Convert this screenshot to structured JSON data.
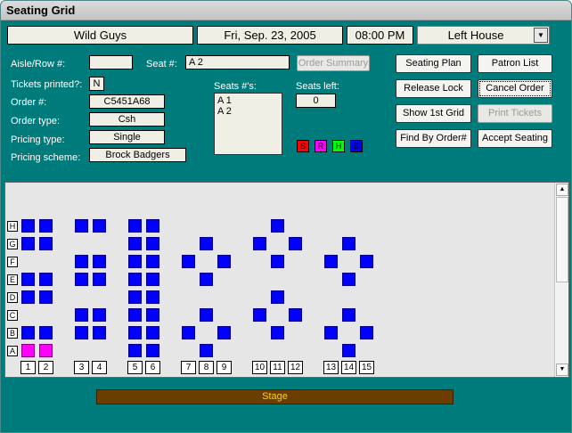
{
  "window": {
    "title": "Seating Grid"
  },
  "header": {
    "event": "Wild Guys",
    "date": "Fri, Sep. 23, 2005",
    "time": "08:00 PM",
    "section": "Left House"
  },
  "form": {
    "aisle_row_label": "Aisle/Row #:",
    "aisle_row_value": "",
    "seat_label": "Seat #:",
    "seat_value": "A 2",
    "tickets_printed_label": "Tickets printed?:",
    "tickets_printed_value": "N",
    "order_label": "Order #:",
    "order_value": "C5451A68",
    "order_type_label": "Order type:",
    "order_type_value": "Csh",
    "pricing_type_label": "Pricing type:",
    "pricing_type_value": "Single",
    "pricing_scheme_label": "Pricing scheme:",
    "pricing_scheme_value": "Brock Badgers",
    "seats_list_label": "Seats #'s:",
    "seats_list": [
      "A 1",
      "A 2"
    ],
    "seats_left_label": "Seats left:",
    "seats_left_value": "0"
  },
  "buttons": {
    "order_summary": "Order Summary",
    "seating_plan": "Seating Plan",
    "patron_list": "Patron List",
    "release_lock": "Release Lock",
    "cancel_order": "Cancel Order",
    "show_first_grid": "Show 1st Grid",
    "print_tickets": "Print Tickets",
    "find_by_order": "Find By Order#",
    "accept_seating": "Accept Seating"
  },
  "color_key": [
    {
      "letter": "S",
      "color": "#ff0000"
    },
    {
      "letter": "R",
      "color": "#ff00ff"
    },
    {
      "letter": "H",
      "color": "#00ff00"
    },
    {
      "letter": "B",
      "color": "#0000ff"
    }
  ],
  "colors": {
    "available_seat": "#0000ff",
    "selected_seat": "#ff00ff",
    "background": "#007b7b",
    "stage": "#6b3d00",
    "stage_text": "#ffd000"
  },
  "grid": {
    "rows": [
      "H",
      "G",
      "F",
      "E",
      "D",
      "C",
      "B",
      "A"
    ],
    "columns": [
      "1",
      "2",
      "3",
      "4",
      "5",
      "6",
      "7",
      "8",
      "9",
      "10",
      "11",
      "12",
      "13",
      "14",
      "15"
    ],
    "seats": [
      {
        "row": "H",
        "cols": [
          "1",
          "2",
          "3",
          "4",
          "5",
          "6",
          "11"
        ]
      },
      {
        "row": "G",
        "cols": [
          "1",
          "2",
          "5",
          "6",
          "8",
          "10",
          "12",
          "14"
        ]
      },
      {
        "row": "F",
        "cols": [
          "3",
          "4",
          "5",
          "6",
          "7",
          "9",
          "11",
          "13",
          "15"
        ]
      },
      {
        "row": "E",
        "cols": [
          "1",
          "2",
          "3",
          "4",
          "5",
          "6",
          "8",
          "14"
        ]
      },
      {
        "row": "D",
        "cols": [
          "1",
          "2",
          "5",
          "6",
          "11"
        ]
      },
      {
        "row": "C",
        "cols": [
          "3",
          "4",
          "5",
          "6",
          "8",
          "10",
          "12",
          "14"
        ]
      },
      {
        "row": "B",
        "cols": [
          "1",
          "2",
          "3",
          "4",
          "5",
          "6",
          "7",
          "9",
          "11",
          "13",
          "15"
        ]
      },
      {
        "row": "A",
        "cols": [
          "1",
          "2",
          "5",
          "6",
          "8",
          "14"
        ]
      }
    ],
    "selected": [
      {
        "row": "A",
        "col": "1"
      },
      {
        "row": "A",
        "col": "2"
      }
    ]
  },
  "stage_label": "Stage"
}
